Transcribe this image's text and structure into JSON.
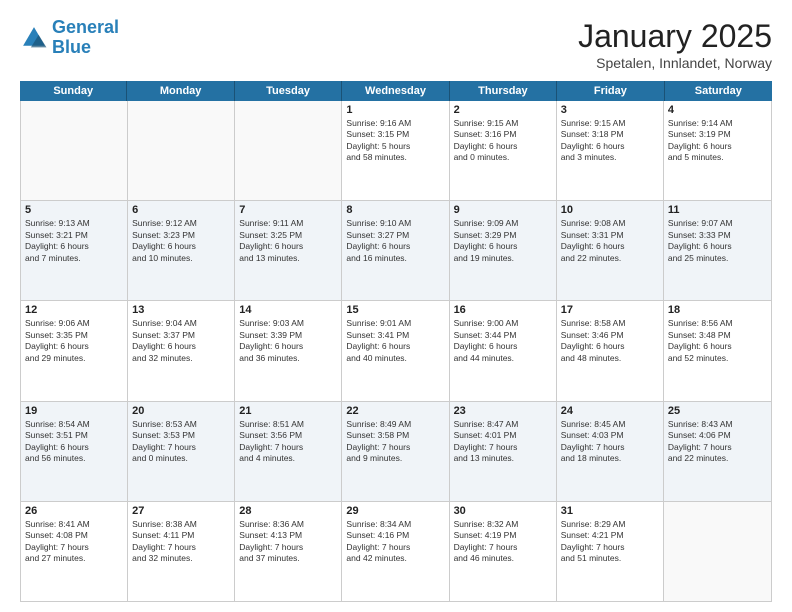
{
  "header": {
    "logo_line1": "General",
    "logo_line2": "Blue",
    "title": "January 2025",
    "subtitle": "Spetalen, Innlandet, Norway"
  },
  "weekdays": [
    "Sunday",
    "Monday",
    "Tuesday",
    "Wednesday",
    "Thursday",
    "Friday",
    "Saturday"
  ],
  "rows": [
    [
      {
        "day": "",
        "text": ""
      },
      {
        "day": "",
        "text": ""
      },
      {
        "day": "",
        "text": ""
      },
      {
        "day": "1",
        "text": "Sunrise: 9:16 AM\nSunset: 3:15 PM\nDaylight: 5 hours\nand 58 minutes."
      },
      {
        "day": "2",
        "text": "Sunrise: 9:15 AM\nSunset: 3:16 PM\nDaylight: 6 hours\nand 0 minutes."
      },
      {
        "day": "3",
        "text": "Sunrise: 9:15 AM\nSunset: 3:18 PM\nDaylight: 6 hours\nand 3 minutes."
      },
      {
        "day": "4",
        "text": "Sunrise: 9:14 AM\nSunset: 3:19 PM\nDaylight: 6 hours\nand 5 minutes."
      }
    ],
    [
      {
        "day": "5",
        "text": "Sunrise: 9:13 AM\nSunset: 3:21 PM\nDaylight: 6 hours\nand 7 minutes."
      },
      {
        "day": "6",
        "text": "Sunrise: 9:12 AM\nSunset: 3:23 PM\nDaylight: 6 hours\nand 10 minutes."
      },
      {
        "day": "7",
        "text": "Sunrise: 9:11 AM\nSunset: 3:25 PM\nDaylight: 6 hours\nand 13 minutes."
      },
      {
        "day": "8",
        "text": "Sunrise: 9:10 AM\nSunset: 3:27 PM\nDaylight: 6 hours\nand 16 minutes."
      },
      {
        "day": "9",
        "text": "Sunrise: 9:09 AM\nSunset: 3:29 PM\nDaylight: 6 hours\nand 19 minutes."
      },
      {
        "day": "10",
        "text": "Sunrise: 9:08 AM\nSunset: 3:31 PM\nDaylight: 6 hours\nand 22 minutes."
      },
      {
        "day": "11",
        "text": "Sunrise: 9:07 AM\nSunset: 3:33 PM\nDaylight: 6 hours\nand 25 minutes."
      }
    ],
    [
      {
        "day": "12",
        "text": "Sunrise: 9:06 AM\nSunset: 3:35 PM\nDaylight: 6 hours\nand 29 minutes."
      },
      {
        "day": "13",
        "text": "Sunrise: 9:04 AM\nSunset: 3:37 PM\nDaylight: 6 hours\nand 32 minutes."
      },
      {
        "day": "14",
        "text": "Sunrise: 9:03 AM\nSunset: 3:39 PM\nDaylight: 6 hours\nand 36 minutes."
      },
      {
        "day": "15",
        "text": "Sunrise: 9:01 AM\nSunset: 3:41 PM\nDaylight: 6 hours\nand 40 minutes."
      },
      {
        "day": "16",
        "text": "Sunrise: 9:00 AM\nSunset: 3:44 PM\nDaylight: 6 hours\nand 44 minutes."
      },
      {
        "day": "17",
        "text": "Sunrise: 8:58 AM\nSunset: 3:46 PM\nDaylight: 6 hours\nand 48 minutes."
      },
      {
        "day": "18",
        "text": "Sunrise: 8:56 AM\nSunset: 3:48 PM\nDaylight: 6 hours\nand 52 minutes."
      }
    ],
    [
      {
        "day": "19",
        "text": "Sunrise: 8:54 AM\nSunset: 3:51 PM\nDaylight: 6 hours\nand 56 minutes."
      },
      {
        "day": "20",
        "text": "Sunrise: 8:53 AM\nSunset: 3:53 PM\nDaylight: 7 hours\nand 0 minutes."
      },
      {
        "day": "21",
        "text": "Sunrise: 8:51 AM\nSunset: 3:56 PM\nDaylight: 7 hours\nand 4 minutes."
      },
      {
        "day": "22",
        "text": "Sunrise: 8:49 AM\nSunset: 3:58 PM\nDaylight: 7 hours\nand 9 minutes."
      },
      {
        "day": "23",
        "text": "Sunrise: 8:47 AM\nSunset: 4:01 PM\nDaylight: 7 hours\nand 13 minutes."
      },
      {
        "day": "24",
        "text": "Sunrise: 8:45 AM\nSunset: 4:03 PM\nDaylight: 7 hours\nand 18 minutes."
      },
      {
        "day": "25",
        "text": "Sunrise: 8:43 AM\nSunset: 4:06 PM\nDaylight: 7 hours\nand 22 minutes."
      }
    ],
    [
      {
        "day": "26",
        "text": "Sunrise: 8:41 AM\nSunset: 4:08 PM\nDaylight: 7 hours\nand 27 minutes."
      },
      {
        "day": "27",
        "text": "Sunrise: 8:38 AM\nSunset: 4:11 PM\nDaylight: 7 hours\nand 32 minutes."
      },
      {
        "day": "28",
        "text": "Sunrise: 8:36 AM\nSunset: 4:13 PM\nDaylight: 7 hours\nand 37 minutes."
      },
      {
        "day": "29",
        "text": "Sunrise: 8:34 AM\nSunset: 4:16 PM\nDaylight: 7 hours\nand 42 minutes."
      },
      {
        "day": "30",
        "text": "Sunrise: 8:32 AM\nSunset: 4:19 PM\nDaylight: 7 hours\nand 46 minutes."
      },
      {
        "day": "31",
        "text": "Sunrise: 8:29 AM\nSunset: 4:21 PM\nDaylight: 7 hours\nand 51 minutes."
      },
      {
        "day": "",
        "text": ""
      }
    ]
  ]
}
